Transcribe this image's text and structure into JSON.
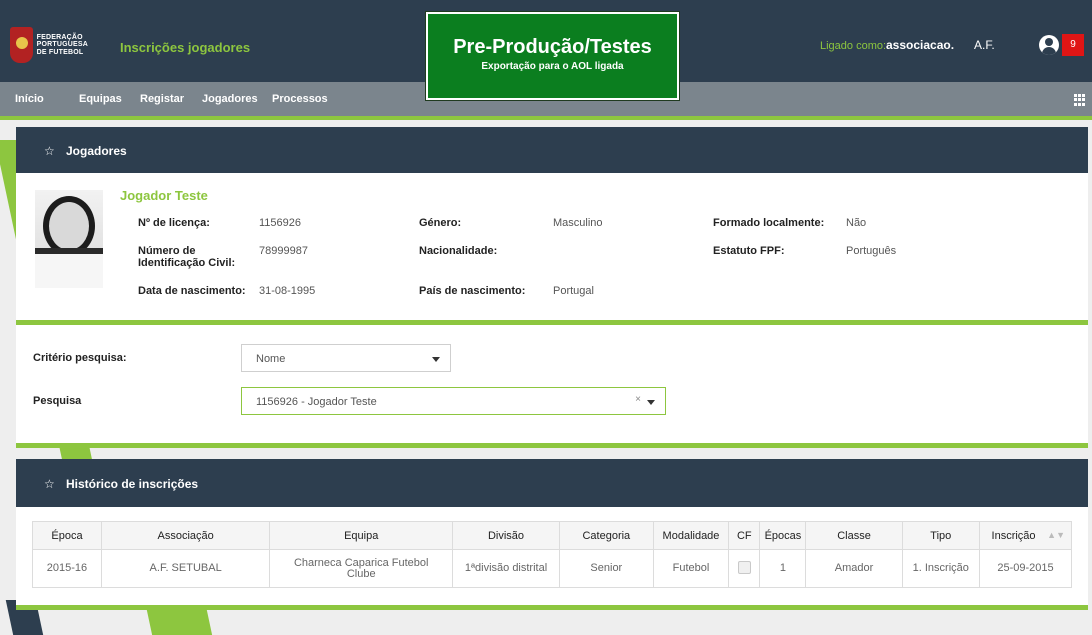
{
  "header": {
    "logo_lines": [
      "FEDERAÇÃO",
      "PORTUGUESA",
      "DE FUTEBOL"
    ],
    "app_title": "Inscrições jogadores",
    "env_title": "Pre-Produção/Testes",
    "env_subtitle": "Exportação para o AOL ligada",
    "login_label": "Ligado como:",
    "username": "associacao.",
    "org": "A.F.",
    "notifications": "9"
  },
  "nav": {
    "items": [
      "Início",
      "Equipas",
      "Registar",
      "Jogadores",
      "Processos"
    ]
  },
  "players_panel": {
    "title": "Jogadores",
    "name": "Jogador Teste",
    "fields": {
      "licenca_label": "Nº de licença:",
      "licenca_value": "1156926",
      "nic_label": "Número de Identificação Civil:",
      "nic_value": "78999987",
      "nascimento_label": "Data de nascimento:",
      "nascimento_value": "31-08-1995",
      "genero_label": "Género:",
      "genero_value": "Masculino",
      "nacionalidade_label": "Nacionalidade:",
      "nacionalidade_value": "",
      "pais_label": "País de nascimento:",
      "pais_value": "Portugal",
      "formado_label": "Formado localmente:",
      "formado_value": "Não",
      "estatuto_label": "Estatuto FPF:",
      "estatuto_value": "Português"
    }
  },
  "search": {
    "criterio_label": "Critério pesquisa:",
    "criterio_value": "Nome",
    "pesquisa_label": "Pesquisa",
    "pesquisa_value": "1156926 - Jogador Teste",
    "clear_symbol": "×"
  },
  "history": {
    "title": "Histórico de inscrições",
    "columns": [
      "Época",
      "Associação",
      "Equipa",
      "Divisão",
      "Categoria",
      "Modalidade",
      "CF",
      "Épocas",
      "Classe",
      "Tipo",
      "Inscrição"
    ],
    "rows": [
      {
        "epoca": "2015-16",
        "associacao": "A.F. SETUBAL",
        "equipa": "Charneca Caparica Futebol Clube",
        "divisao": "1ªdivisão distrital",
        "categoria": "Senior",
        "modalidade": "Futebol",
        "cf": false,
        "epocas": "1",
        "classe": "Amador",
        "tipo": "1. Inscrição",
        "inscricao": "25-09-2015"
      }
    ]
  },
  "colors": {
    "navy": "#2d3e4f",
    "green": "#8dc63f",
    "env_green": "#0b7e1f",
    "nav_grey": "#7b858d",
    "badge_red": "#e01515"
  }
}
